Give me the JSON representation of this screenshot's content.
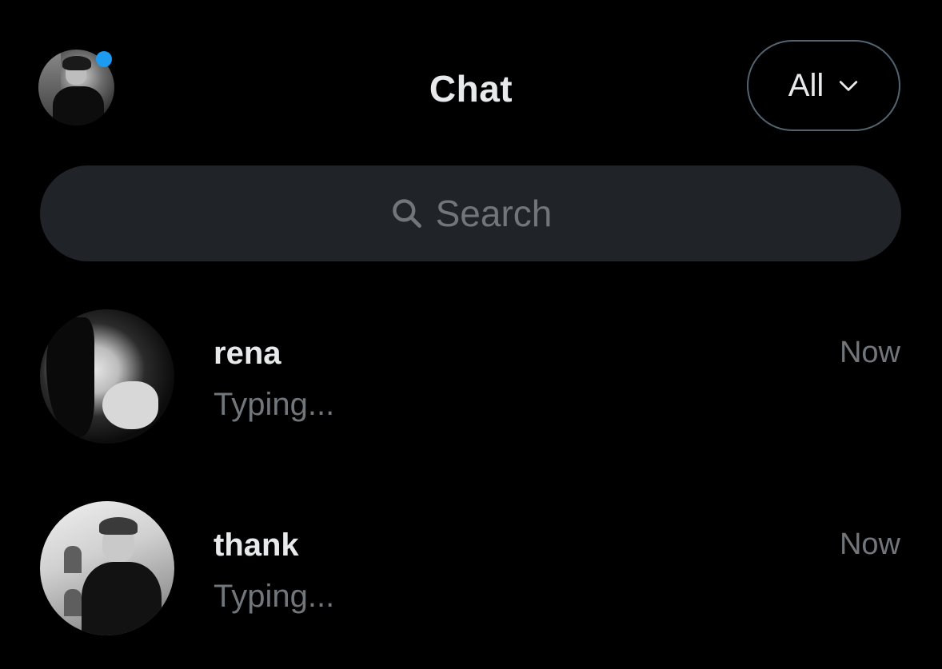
{
  "header": {
    "title": "Chat",
    "filter": {
      "label": "All",
      "icon": "chevron-down-icon"
    },
    "avatar": {
      "presence_color": "#1d9bf0"
    }
  },
  "search": {
    "placeholder": "Search",
    "icon": "search-icon"
  },
  "chats": [
    {
      "name": "rena",
      "preview": "Typing...",
      "time": "Now"
    },
    {
      "name": "thank",
      "preview": "Typing...",
      "time": "Now"
    }
  ],
  "colors": {
    "background": "#000000",
    "primary_text": "#e7e9ea",
    "secondary_text": "#71767b",
    "search_background": "#202327",
    "accent": "#1d9bf0"
  }
}
